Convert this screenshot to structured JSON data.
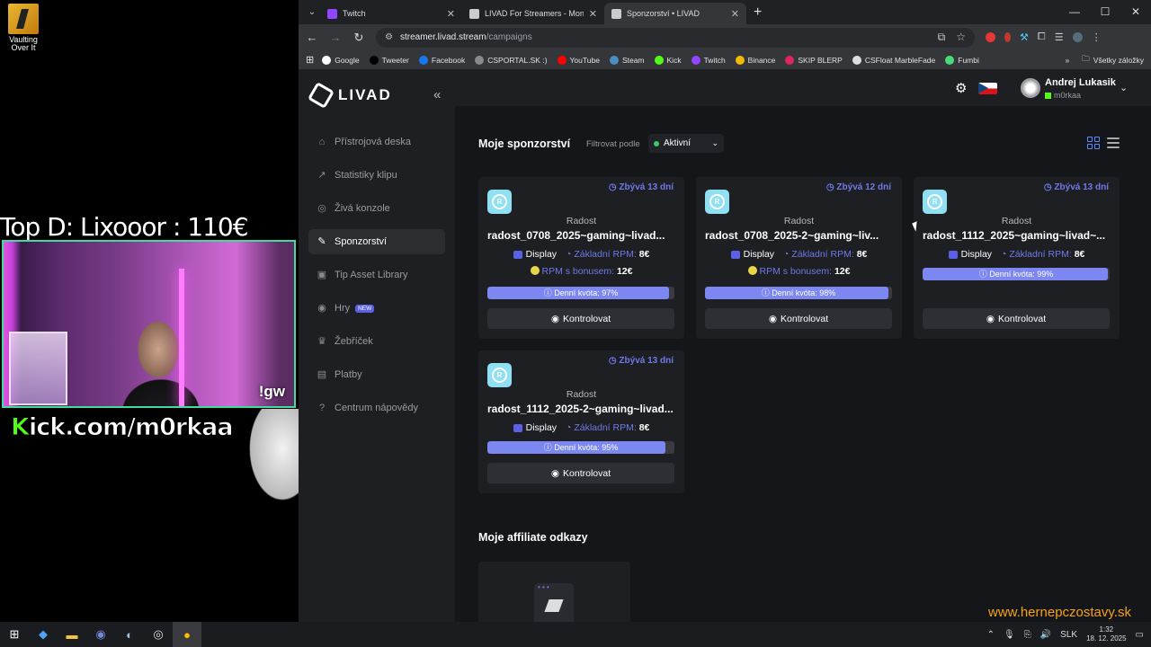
{
  "desktop": {
    "icon_label": "Vaulting Over It"
  },
  "overlay": {
    "top_donator": "Top D: Lixooor : 110€",
    "cam_command": "!gw",
    "kick_prefix": "K",
    "kick_rest": "ick.com/m0rkaa",
    "watermark": "www.hernepczostavy.sk"
  },
  "browser": {
    "tabs": [
      {
        "title": "Twitch",
        "icon": "twitch-icon",
        "color": "#9146ff"
      },
      {
        "title": "LIVAD For Streamers - Monetiz",
        "icon": "livad-icon",
        "color": "#cccccc"
      },
      {
        "title": "Sponzorství • LIVAD",
        "icon": "livad-icon",
        "color": "#cccccc"
      }
    ],
    "url_host": "streamer.livad.stream",
    "url_path": "/campaigns",
    "bookmarks": [
      {
        "label": "Google",
        "color": "#ffffff"
      },
      {
        "label": "Tweeter",
        "color": "#000000"
      },
      {
        "label": "Facebook",
        "color": "#1877f2"
      },
      {
        "label": "CSPORTAL.SK :)",
        "color": "#8a8a8a"
      },
      {
        "label": "YouTube",
        "color": "#ff0000"
      },
      {
        "label": "Steam",
        "color": "#4b8ec2"
      },
      {
        "label": "Kick",
        "color": "#53fc18"
      },
      {
        "label": "Twitch",
        "color": "#9146ff"
      },
      {
        "label": "Binance",
        "color": "#f0b90b"
      },
      {
        "label": "SKIP BLERP",
        "color": "#e0245e"
      },
      {
        "label": "CSFloat MarbleFade",
        "color": "#dddddd"
      },
      {
        "label": "Fumbi",
        "color": "#4bd97a"
      }
    ],
    "all_bookmarks": "Všetky záložky"
  },
  "app": {
    "logo": "LIVAD",
    "nav": [
      {
        "label": "Přístrojová deska",
        "icon": "home-icon",
        "glyph": "⌂"
      },
      {
        "label": "Statistiky klipu",
        "icon": "chart-icon",
        "glyph": "↗"
      },
      {
        "label": "Živá konzole",
        "icon": "console-icon",
        "glyph": "◎"
      },
      {
        "label": "Sponzorství",
        "icon": "megaphone-icon",
        "glyph": "✎"
      },
      {
        "label": "Tip Asset Library",
        "icon": "library-icon",
        "glyph": "▣"
      },
      {
        "label": "Hry",
        "icon": "gamepad-icon",
        "glyph": "◉",
        "badge": "NEW"
      },
      {
        "label": "Žebříček",
        "icon": "trophy-icon",
        "glyph": "♛"
      },
      {
        "label": "Platby",
        "icon": "payments-icon",
        "glyph": "▤"
      },
      {
        "label": "Centrum nápovědy",
        "icon": "help-icon",
        "glyph": "?"
      }
    ],
    "user": {
      "name": "Andrej Lukasik",
      "handle": "m0rkaa"
    },
    "section_title": "Moje sponzorství",
    "filter_label": "Filtrovat podle",
    "filter_value": "Aktivní",
    "campaigns": [
      {
        "days": "Zbývá 13 dní",
        "brand": "Radost",
        "name": "radost_0708_2025~gaming~livad...",
        "format": "Display",
        "rpm_label": "Základní RPM:",
        "rpm_value": "8€",
        "bonus_label": "RPM s bonusem:",
        "bonus_value": "12€",
        "quota_label": "Denní kvóta: 97%",
        "quota": 0.97,
        "action": "Kontrolovat"
      },
      {
        "days": "Zbývá 12 dní",
        "brand": "Radost",
        "name": "radost_0708_2025-2~gaming~liv...",
        "format": "Display",
        "rpm_label": "Základní RPM:",
        "rpm_value": "8€",
        "bonus_label": "RPM s bonusem:",
        "bonus_value": "12€",
        "quota_label": "Denní kvóta: 98%",
        "quota": 0.98,
        "action": "Kontrolovat"
      },
      {
        "days": "Zbývá 13 dní",
        "brand": "Radost",
        "name": "radost_1112_2025~gaming~livad~...",
        "format": "Display",
        "rpm_label": "Základní RPM:",
        "rpm_value": "8€",
        "quota_label": "Denní kvóta: 99%",
        "quota": 0.99,
        "action": "Kontrolovat"
      },
      {
        "days": "Zbývá 13 dní",
        "brand": "Radost",
        "name": "radost_1112_2025-2~gaming~livad...",
        "format": "Display",
        "rpm_label": "Základní RPM:",
        "rpm_value": "8€",
        "quota_label": "Denní kvóta: 95%",
        "quota": 0.95,
        "action": "Kontrolovat"
      }
    ],
    "affiliate_title": "Moje affiliate odkazy"
  },
  "taskbar": {
    "lang": "SLK",
    "time": "1:32",
    "date": "18. 12. 2025"
  }
}
